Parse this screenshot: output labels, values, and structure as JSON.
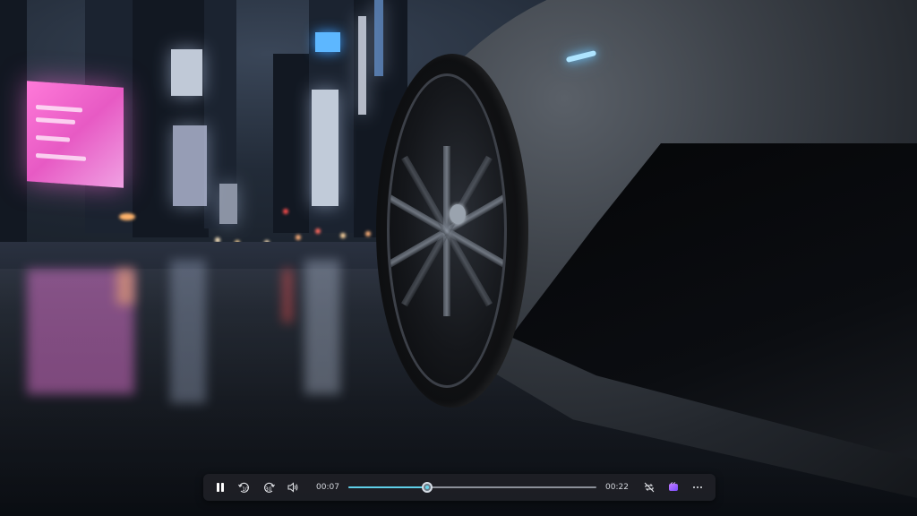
{
  "player": {
    "current_time": "00:07",
    "duration": "00:22",
    "progress": 0.318,
    "state": "playing",
    "accent_color": "#5fd0e8"
  },
  "controls": {
    "play_pause_icon": "pause-icon",
    "skip_back_label": "10",
    "skip_forward_label": "30",
    "skip_back_icon": "rewind-10-icon",
    "skip_forward_icon": "forward-30-icon",
    "volume_icon": "volume-icon",
    "repeat_icon": "repeat-icon",
    "clipchamp_icon": "clipchamp-icon",
    "more_icon": "more-options-icon"
  },
  "colors": {
    "bar_bg": "#1e2026",
    "clipchamp": "#a66cff"
  }
}
